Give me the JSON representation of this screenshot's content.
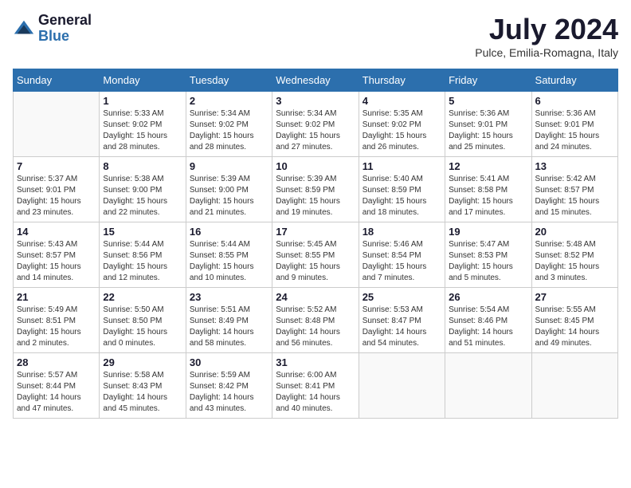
{
  "header": {
    "logo_line1": "General",
    "logo_line2": "Blue",
    "month": "July 2024",
    "location": "Pulce, Emilia-Romagna, Italy"
  },
  "weekdays": [
    "Sunday",
    "Monday",
    "Tuesday",
    "Wednesday",
    "Thursday",
    "Friday",
    "Saturday"
  ],
  "weeks": [
    [
      {
        "day": "",
        "info": ""
      },
      {
        "day": "1",
        "info": "Sunrise: 5:33 AM\nSunset: 9:02 PM\nDaylight: 15 hours\nand 28 minutes."
      },
      {
        "day": "2",
        "info": "Sunrise: 5:34 AM\nSunset: 9:02 PM\nDaylight: 15 hours\nand 28 minutes."
      },
      {
        "day": "3",
        "info": "Sunrise: 5:34 AM\nSunset: 9:02 PM\nDaylight: 15 hours\nand 27 minutes."
      },
      {
        "day": "4",
        "info": "Sunrise: 5:35 AM\nSunset: 9:02 PM\nDaylight: 15 hours\nand 26 minutes."
      },
      {
        "day": "5",
        "info": "Sunrise: 5:36 AM\nSunset: 9:01 PM\nDaylight: 15 hours\nand 25 minutes."
      },
      {
        "day": "6",
        "info": "Sunrise: 5:36 AM\nSunset: 9:01 PM\nDaylight: 15 hours\nand 24 minutes."
      }
    ],
    [
      {
        "day": "7",
        "info": "Sunrise: 5:37 AM\nSunset: 9:01 PM\nDaylight: 15 hours\nand 23 minutes."
      },
      {
        "day": "8",
        "info": "Sunrise: 5:38 AM\nSunset: 9:00 PM\nDaylight: 15 hours\nand 22 minutes."
      },
      {
        "day": "9",
        "info": "Sunrise: 5:39 AM\nSunset: 9:00 PM\nDaylight: 15 hours\nand 21 minutes."
      },
      {
        "day": "10",
        "info": "Sunrise: 5:39 AM\nSunset: 8:59 PM\nDaylight: 15 hours\nand 19 minutes."
      },
      {
        "day": "11",
        "info": "Sunrise: 5:40 AM\nSunset: 8:59 PM\nDaylight: 15 hours\nand 18 minutes."
      },
      {
        "day": "12",
        "info": "Sunrise: 5:41 AM\nSunset: 8:58 PM\nDaylight: 15 hours\nand 17 minutes."
      },
      {
        "day": "13",
        "info": "Sunrise: 5:42 AM\nSunset: 8:57 PM\nDaylight: 15 hours\nand 15 minutes."
      }
    ],
    [
      {
        "day": "14",
        "info": "Sunrise: 5:43 AM\nSunset: 8:57 PM\nDaylight: 15 hours\nand 14 minutes."
      },
      {
        "day": "15",
        "info": "Sunrise: 5:44 AM\nSunset: 8:56 PM\nDaylight: 15 hours\nand 12 minutes."
      },
      {
        "day": "16",
        "info": "Sunrise: 5:44 AM\nSunset: 8:55 PM\nDaylight: 15 hours\nand 10 minutes."
      },
      {
        "day": "17",
        "info": "Sunrise: 5:45 AM\nSunset: 8:55 PM\nDaylight: 15 hours\nand 9 minutes."
      },
      {
        "day": "18",
        "info": "Sunrise: 5:46 AM\nSunset: 8:54 PM\nDaylight: 15 hours\nand 7 minutes."
      },
      {
        "day": "19",
        "info": "Sunrise: 5:47 AM\nSunset: 8:53 PM\nDaylight: 15 hours\nand 5 minutes."
      },
      {
        "day": "20",
        "info": "Sunrise: 5:48 AM\nSunset: 8:52 PM\nDaylight: 15 hours\nand 3 minutes."
      }
    ],
    [
      {
        "day": "21",
        "info": "Sunrise: 5:49 AM\nSunset: 8:51 PM\nDaylight: 15 hours\nand 2 minutes."
      },
      {
        "day": "22",
        "info": "Sunrise: 5:50 AM\nSunset: 8:50 PM\nDaylight: 15 hours\nand 0 minutes."
      },
      {
        "day": "23",
        "info": "Sunrise: 5:51 AM\nSunset: 8:49 PM\nDaylight: 14 hours\nand 58 minutes."
      },
      {
        "day": "24",
        "info": "Sunrise: 5:52 AM\nSunset: 8:48 PM\nDaylight: 14 hours\nand 56 minutes."
      },
      {
        "day": "25",
        "info": "Sunrise: 5:53 AM\nSunset: 8:47 PM\nDaylight: 14 hours\nand 54 minutes."
      },
      {
        "day": "26",
        "info": "Sunrise: 5:54 AM\nSunset: 8:46 PM\nDaylight: 14 hours\nand 51 minutes."
      },
      {
        "day": "27",
        "info": "Sunrise: 5:55 AM\nSunset: 8:45 PM\nDaylight: 14 hours\nand 49 minutes."
      }
    ],
    [
      {
        "day": "28",
        "info": "Sunrise: 5:57 AM\nSunset: 8:44 PM\nDaylight: 14 hours\nand 47 minutes."
      },
      {
        "day": "29",
        "info": "Sunrise: 5:58 AM\nSunset: 8:43 PM\nDaylight: 14 hours\nand 45 minutes."
      },
      {
        "day": "30",
        "info": "Sunrise: 5:59 AM\nSunset: 8:42 PM\nDaylight: 14 hours\nand 43 minutes."
      },
      {
        "day": "31",
        "info": "Sunrise: 6:00 AM\nSunset: 8:41 PM\nDaylight: 14 hours\nand 40 minutes."
      },
      {
        "day": "",
        "info": ""
      },
      {
        "day": "",
        "info": ""
      },
      {
        "day": "",
        "info": ""
      }
    ]
  ]
}
